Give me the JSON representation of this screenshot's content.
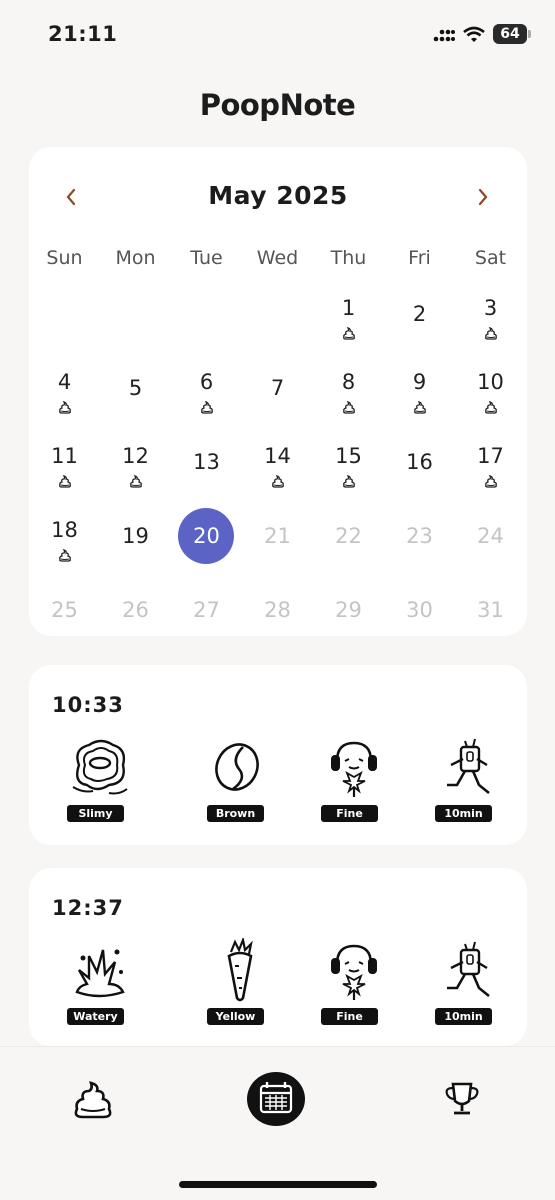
{
  "status_bar": {
    "time": "21:11",
    "battery": "64"
  },
  "app": {
    "title": "PoopNote"
  },
  "calendar": {
    "month_label": "May 2025",
    "weekdays": [
      "Sun",
      "Mon",
      "Tue",
      "Wed",
      "Thu",
      "Fri",
      "Sat"
    ],
    "days": [
      {
        "n": "",
        "muted": false,
        "poop": false,
        "selected": false
      },
      {
        "n": "",
        "muted": false,
        "poop": false,
        "selected": false
      },
      {
        "n": "",
        "muted": false,
        "poop": false,
        "selected": false
      },
      {
        "n": "",
        "muted": false,
        "poop": false,
        "selected": false
      },
      {
        "n": "1",
        "muted": false,
        "poop": true,
        "selected": false
      },
      {
        "n": "2",
        "muted": false,
        "poop": false,
        "selected": false
      },
      {
        "n": "3",
        "muted": false,
        "poop": true,
        "selected": false
      },
      {
        "n": "4",
        "muted": false,
        "poop": true,
        "selected": false
      },
      {
        "n": "5",
        "muted": false,
        "poop": false,
        "selected": false
      },
      {
        "n": "6",
        "muted": false,
        "poop": true,
        "selected": false
      },
      {
        "n": "7",
        "muted": false,
        "poop": false,
        "selected": false
      },
      {
        "n": "8",
        "muted": false,
        "poop": true,
        "selected": false
      },
      {
        "n": "9",
        "muted": false,
        "poop": true,
        "selected": false
      },
      {
        "n": "10",
        "muted": false,
        "poop": true,
        "selected": false
      },
      {
        "n": "11",
        "muted": false,
        "poop": true,
        "selected": false
      },
      {
        "n": "12",
        "muted": false,
        "poop": true,
        "selected": false
      },
      {
        "n": "13",
        "muted": false,
        "poop": false,
        "selected": false
      },
      {
        "n": "14",
        "muted": false,
        "poop": true,
        "selected": false
      },
      {
        "n": "15",
        "muted": false,
        "poop": true,
        "selected": false
      },
      {
        "n": "16",
        "muted": false,
        "poop": false,
        "selected": false
      },
      {
        "n": "17",
        "muted": false,
        "poop": true,
        "selected": false
      },
      {
        "n": "18",
        "muted": false,
        "poop": true,
        "selected": false
      },
      {
        "n": "19",
        "muted": false,
        "poop": false,
        "selected": false
      },
      {
        "n": "20",
        "muted": false,
        "poop": false,
        "selected": true
      },
      {
        "n": "21",
        "muted": true,
        "poop": false,
        "selected": false
      },
      {
        "n": "22",
        "muted": true,
        "poop": false,
        "selected": false
      },
      {
        "n": "23",
        "muted": true,
        "poop": false,
        "selected": false
      },
      {
        "n": "24",
        "muted": true,
        "poop": false,
        "selected": false
      },
      {
        "n": "25",
        "muted": true,
        "poop": false,
        "selected": false
      },
      {
        "n": "26",
        "muted": true,
        "poop": false,
        "selected": false
      },
      {
        "n": "27",
        "muted": true,
        "poop": false,
        "selected": false
      },
      {
        "n": "28",
        "muted": true,
        "poop": false,
        "selected": false
      },
      {
        "n": "29",
        "muted": true,
        "poop": false,
        "selected": false
      },
      {
        "n": "30",
        "muted": true,
        "poop": false,
        "selected": false
      },
      {
        "n": "31",
        "muted": true,
        "poop": false,
        "selected": false
      }
    ]
  },
  "entries": [
    {
      "time": "10:33",
      "tags": [
        {
          "label": "Slimy",
          "icon": "slimy-icon"
        },
        {
          "label": "Brown",
          "icon": "coffee-bean-icon"
        },
        {
          "label": "Fine",
          "icon": "headphones-face-icon"
        },
        {
          "label": "10min",
          "icon": "running-timer-icon"
        }
      ]
    },
    {
      "time": "12:37",
      "tags": [
        {
          "label": "Watery",
          "icon": "splash-icon"
        },
        {
          "label": "Yellow",
          "icon": "carrot-icon"
        },
        {
          "label": "Fine",
          "icon": "headphones-face-icon"
        },
        {
          "label": "10min",
          "icon": "running-timer-icon"
        }
      ]
    }
  ],
  "colors": {
    "accent": "#5b64c4",
    "nav_arrow": "#8a4a2a",
    "background": "#f7f6f4"
  }
}
